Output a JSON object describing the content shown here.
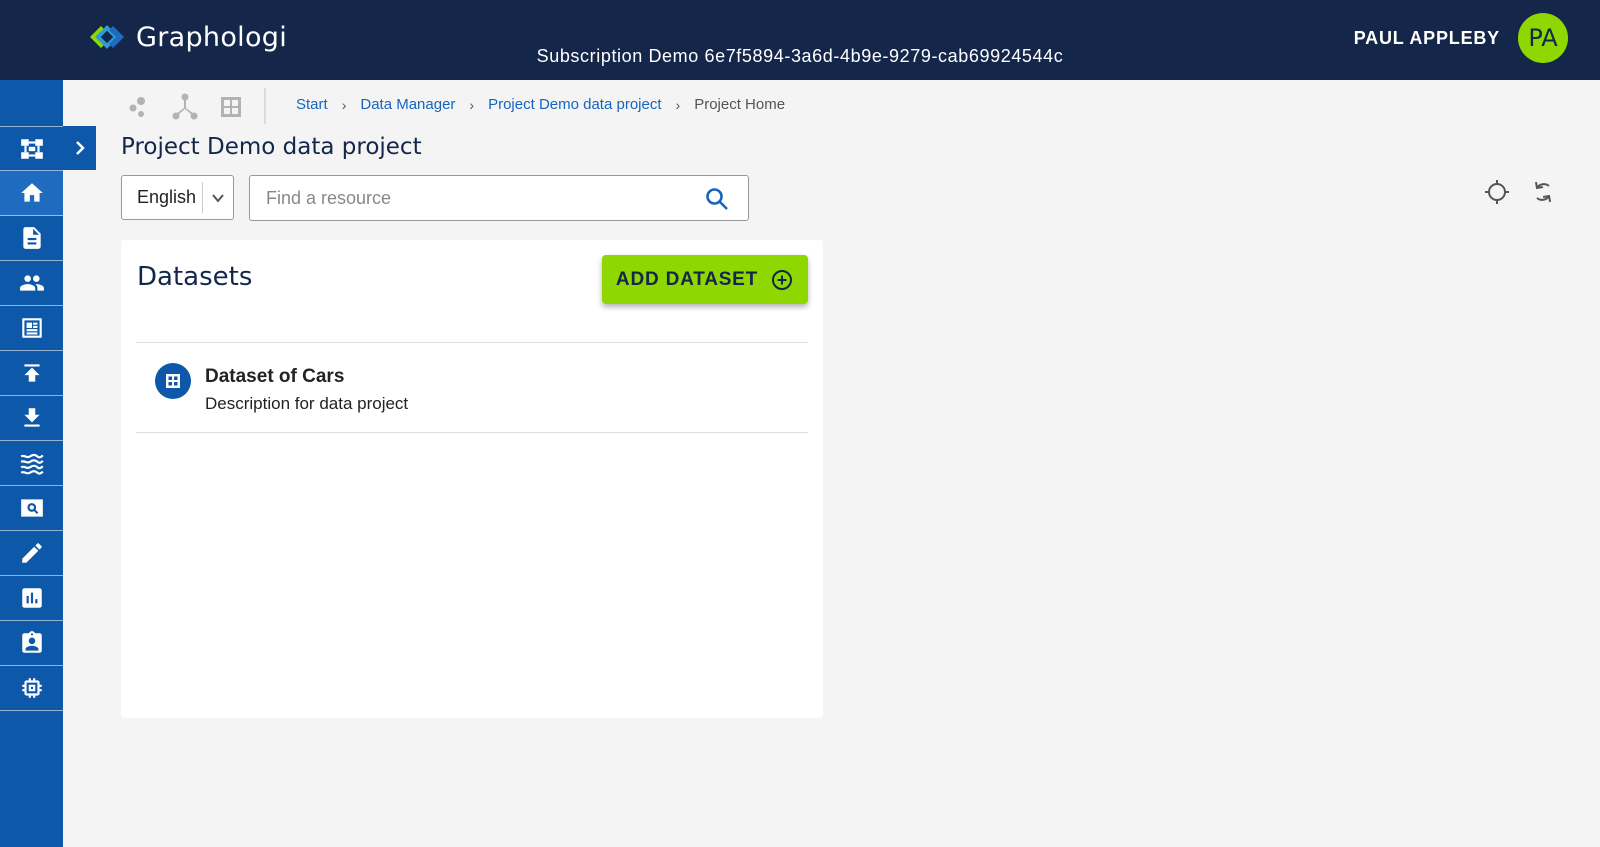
{
  "header": {
    "app_name": "Graphologi",
    "subscription": "Subscription Demo 6e7f5894-3a6d-4b9e-9279-cab69924544c",
    "user_name": "PAUL APPLEBY",
    "user_initials": "PA"
  },
  "sidebar": {
    "items": [
      {
        "icon": "network-icon"
      },
      {
        "icon": "home-icon",
        "active": true
      },
      {
        "icon": "document-icon"
      },
      {
        "icon": "people-icon"
      },
      {
        "icon": "dashboard-icon"
      },
      {
        "icon": "upload-icon"
      },
      {
        "icon": "download-icon"
      },
      {
        "icon": "waves-icon"
      },
      {
        "icon": "search-card-icon"
      },
      {
        "icon": "edit-icon"
      },
      {
        "icon": "chart-icon"
      },
      {
        "icon": "badge-icon"
      },
      {
        "icon": "chip-icon"
      }
    ]
  },
  "breadcrumb": {
    "items": [
      "Start",
      "Data Manager",
      "Project Demo data project"
    ],
    "current": "Project Home"
  },
  "page": {
    "title": "Project Demo data project",
    "language": "English",
    "search_placeholder": "Find a resource"
  },
  "datasets": {
    "title": "Datasets",
    "add_button": "ADD DATASET",
    "items": [
      {
        "title": "Dataset of Cars",
        "description": "Description for data project"
      }
    ]
  },
  "colors": {
    "header_bg": "#14274a",
    "sidebar_bg": "#0d58a8",
    "accent_green": "#8ed700",
    "link_blue": "#1565c0"
  }
}
